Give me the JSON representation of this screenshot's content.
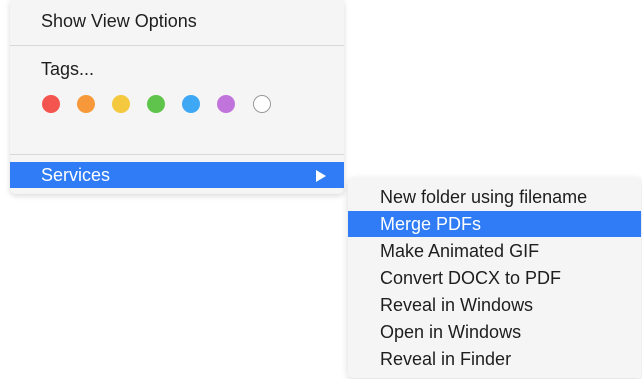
{
  "context_menu": {
    "show_view_options": "Show View Options",
    "tags_label": "Tags...",
    "tag_colors": [
      {
        "name": "red",
        "color": "#f5554f"
      },
      {
        "name": "orange",
        "color": "#f7993a"
      },
      {
        "name": "yellow",
        "color": "#f5c93f"
      },
      {
        "name": "green",
        "color": "#5fc44b"
      },
      {
        "name": "blue",
        "color": "#3ea8f5"
      },
      {
        "name": "purple",
        "color": "#c174dc"
      },
      {
        "name": "none",
        "color": "#ffffff"
      }
    ],
    "services_label": "Services",
    "services_arrow_icon": "triangle-right-icon"
  },
  "services_submenu": {
    "items": [
      {
        "label": "New folder using filename",
        "highlighted": false
      },
      {
        "label": "Merge PDFs",
        "highlighted": true
      },
      {
        "label": "Make Animated GIF",
        "highlighted": false
      },
      {
        "label": "Convert DOCX to PDF",
        "highlighted": false
      },
      {
        "label": "Reveal in Windows",
        "highlighted": false
      },
      {
        "label": "Open in Windows",
        "highlighted": false
      },
      {
        "label": "Reveal in Finder",
        "highlighted": false
      }
    ]
  },
  "colors": {
    "menu_background": "#f5f5f5",
    "highlight": "#2f7cf6",
    "text": "#1e1e1e"
  }
}
